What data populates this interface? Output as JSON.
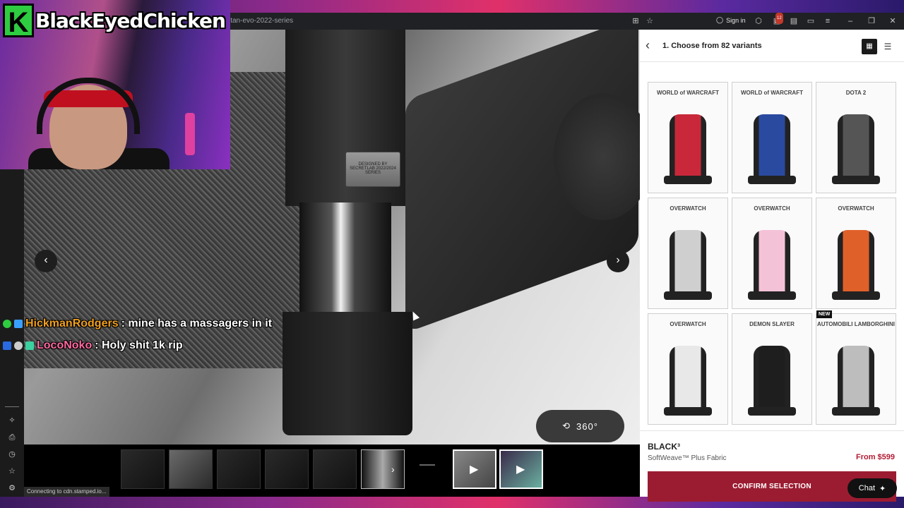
{
  "browser": {
    "url": "itan-evo-2022-series",
    "sign_in": "Sign in",
    "notification_count": "12",
    "status_text": "Connecting to cdn.stamped.io..."
  },
  "stream": {
    "channel_name": "BlackEyedChicken",
    "logo_letter": "K",
    "chat": [
      {
        "user": "HickmanRodgers",
        "message": ": mine has a massagers in it",
        "color": "#f0a020"
      },
      {
        "user": "LocoNoko",
        "message": ": Holy shit 1k rip",
        "color": "#ff6aa0"
      }
    ]
  },
  "gallery": {
    "plate_text": "DESIGNED BY SECRETLAB 2022/2024 SERIES",
    "view_360_label": "360°"
  },
  "panel": {
    "title": "1. Choose from 82 variants",
    "variants": [
      {
        "logo": "WORLD of WARCRAFT",
        "color": "#c8283a"
      },
      {
        "logo": "WORLD of WARCRAFT",
        "color": "#2a4aa0"
      },
      {
        "logo": "DOTA 2",
        "color": "#555555"
      },
      {
        "logo": "OVERWATCH",
        "color": "#cfcfcf"
      },
      {
        "logo": "OVERWATCH",
        "color": "#f4c2d6"
      },
      {
        "logo": "OVERWATCH",
        "color": "#e0602a"
      },
      {
        "logo": "OVERWATCH",
        "color": "#e8e8e8"
      },
      {
        "logo": "DEMON SLAYER",
        "color": "#1e1e1e"
      },
      {
        "logo": "AUTOMOBILI LAMBORGHINI",
        "color": "#bdbdbd"
      }
    ],
    "new_badge": "NEW",
    "product_name": "BLACK³",
    "material": "SoftWeave™ Plus Fabric",
    "price": "From $599",
    "confirm_label": "CONFIRM SELECTION",
    "chat_label": "Chat"
  }
}
